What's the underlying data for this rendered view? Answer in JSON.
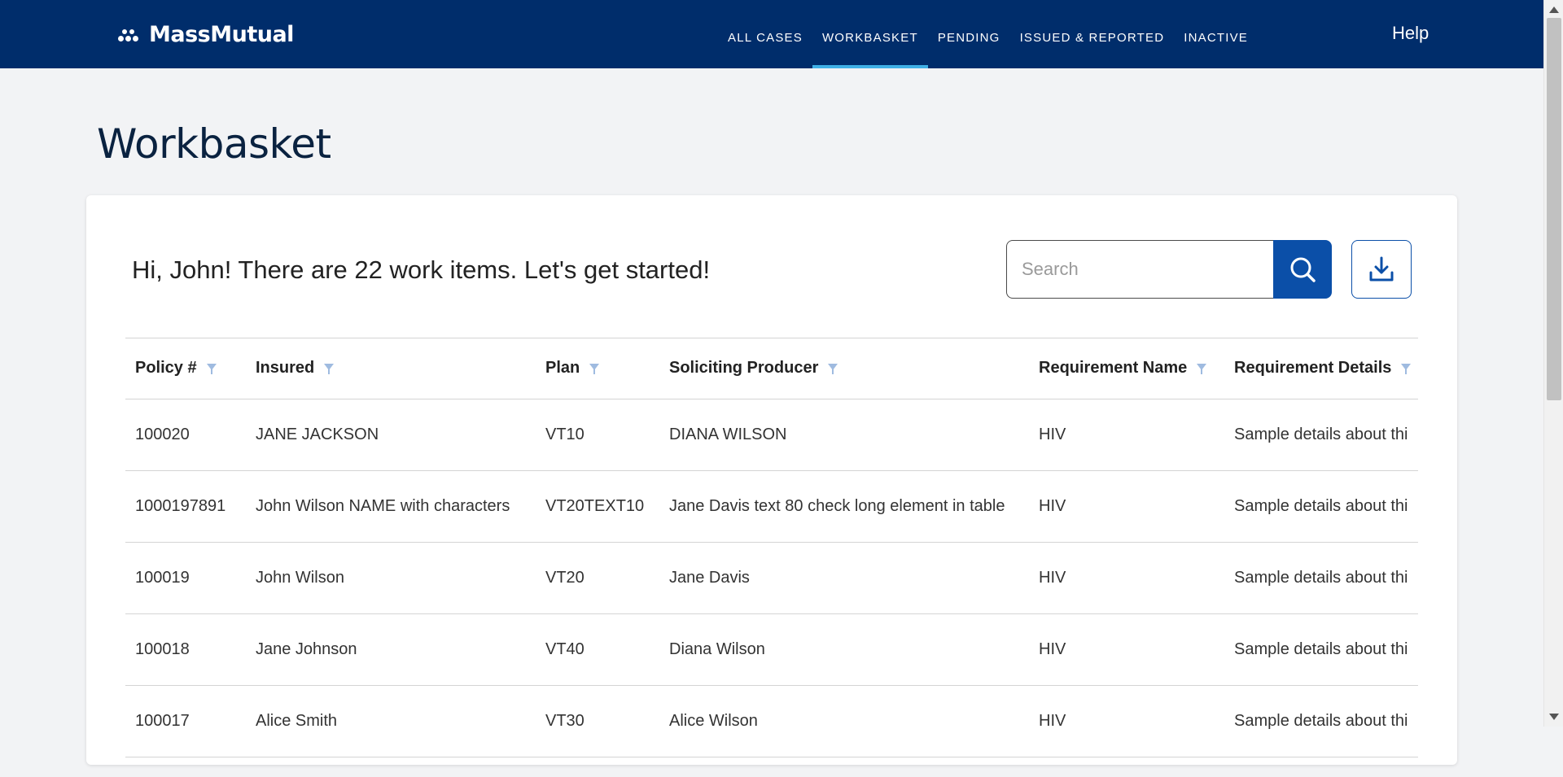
{
  "brand": {
    "name": "MassMutual"
  },
  "nav": {
    "items": [
      {
        "label": "ALL CASES",
        "active": false
      },
      {
        "label": "WORKBASKET",
        "active": true
      },
      {
        "label": "PENDING",
        "active": false
      },
      {
        "label": "ISSUED & REPORTED",
        "active": false
      },
      {
        "label": "INACTIVE",
        "active": false
      }
    ],
    "help_label": "Help"
  },
  "page": {
    "title": "Workbasket",
    "greeting_prefix": "Hi, John! There are ",
    "item_count": "22",
    "greeting_suffix": " work items. Let's get started!"
  },
  "search": {
    "placeholder": "Search",
    "value": ""
  },
  "icons": {
    "search": "search-icon",
    "download": "download-icon",
    "filter": "filter-icon"
  },
  "colors": {
    "nav_bg": "#002d6b",
    "nav_active_underline": "#3fb0e6",
    "primary_button": "#0b4fa8",
    "filter_icon": "#9fbbe0"
  },
  "table": {
    "columns": [
      "Policy #",
      "Insured",
      "Plan",
      "Soliciting Producer",
      "Requirement Name",
      "Requirement Details"
    ],
    "rows": [
      [
        "100020",
        "JANE JACKSON",
        "VT10",
        "DIANA WILSON",
        "HIV",
        "Sample details about thi"
      ],
      [
        "1000197891",
        "John Wilson NAME with characters",
        "VT20TEXT10",
        "Jane Davis text 80 check long element in table",
        "HIV",
        "Sample details about thi"
      ],
      [
        "100019",
        "John Wilson",
        "VT20",
        "Jane Davis",
        "HIV",
        "Sample details about thi"
      ],
      [
        "100018",
        "Jane Johnson",
        "VT40",
        "Diana Wilson",
        "HIV",
        "Sample details about thi"
      ],
      [
        "100017",
        "Alice Smith",
        "VT30",
        "Alice Wilson",
        "HIV",
        "Sample details about thi"
      ]
    ]
  }
}
